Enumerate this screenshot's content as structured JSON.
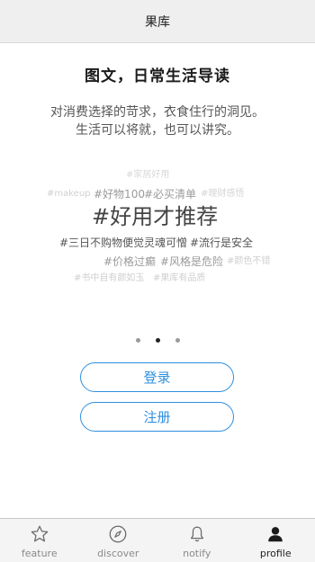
{
  "navbar": {
    "title": "果库"
  },
  "intro": {
    "headline": "图文，日常生活导读",
    "line1": "对消费选择的苛求，衣食住行的洞见。",
    "line2": "生活可以将就，也可以讲究。"
  },
  "tag_cloud": [
    {
      "text": "#家居好用",
      "color": "#d8d8d8"
    },
    {
      "text": "#makeup",
      "color": "#d0d0d0"
    },
    {
      "text": "#好物100",
      "color": "#9a9a9a"
    },
    {
      "text": "#必买清单",
      "color": "#9a9a9a"
    },
    {
      "text": "#理财感悟",
      "color": "#d4d4d4"
    },
    {
      "text": "#好用才推荐",
      "color": "#444444"
    },
    {
      "text": "#三日不购物便觉灵魂可憎",
      "color": "#555555"
    },
    {
      "text": "#流行是安全",
      "color": "#555555"
    },
    {
      "text": "#价格过癫",
      "color": "#9a9a9a"
    },
    {
      "text": "#风格是危险",
      "color": "#9a9a9a"
    },
    {
      "text": "#颜色不错",
      "color": "#d0d0d0"
    },
    {
      "text": "#书中自有颜如玉",
      "color": "#cfcfcf"
    },
    {
      "text": "#果库有品质",
      "color": "#cfcfcf"
    }
  ],
  "carousel": {
    "pages": 3,
    "active": 2
  },
  "buttons": {
    "login": "登录",
    "register": "注册"
  },
  "tabs": [
    {
      "label": "feature",
      "icon": "star-icon"
    },
    {
      "label": "discover",
      "icon": "compass-icon"
    },
    {
      "label": "notify",
      "icon": "bell-icon"
    },
    {
      "label": "profile",
      "icon": "user-icon",
      "active": true
    }
  ]
}
